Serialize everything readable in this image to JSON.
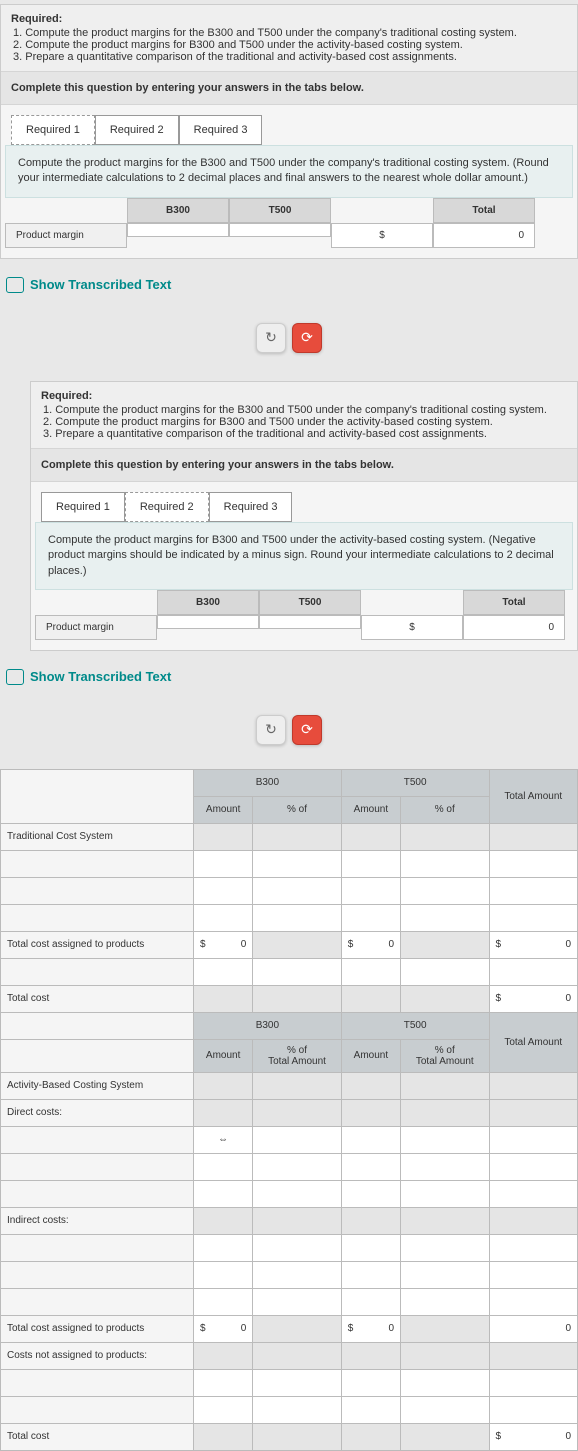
{
  "req": {
    "title": "Required:",
    "items": [
      "1. Compute the product margins for the B300 and T500 under the company's traditional costing system.",
      "2. Compute the product margins for B300 and T500 under the activity-based costing system.",
      "3. Prepare a quantitative comparison of the traditional and activity-based cost assignments."
    ]
  },
  "complete": "Complete this question by entering your answers in the tabs below.",
  "tabs": [
    "Required 1",
    "Required 2",
    "Required 3"
  ],
  "instr1": "Compute the product margins for the B300 and T500 under the company's traditional costing system. (Round your intermediate calculations to 2 decimal places and final answers to the nearest whole dollar amount.)",
  "instr2": "Compute the product margins for B300 and T500 under the activity-based costing system. (Negative product margins should be indicated by a minus sign. Round your intermediate calculations to 2 decimal places.)",
  "cols": {
    "b300": "B300",
    "t500": "T500",
    "total": "Total"
  },
  "row_pm": "Product margin",
  "currency": "$",
  "zero": "0",
  "show_link": "Show Transcribed Text",
  "refresh": "↻",
  "reload": "⟳",
  "comp": {
    "b300": "B300",
    "t500": "T500",
    "amount": "Amount",
    "pct": "% of",
    "total_amt": "Total Amount",
    "total_am": "Total\nAmount",
    "rows": {
      "trad": "Traditional Cost System",
      "tcap": "Total cost assigned to products",
      "tcost": "Total cost",
      "abc": "Activity-Based Costing System",
      "direct": "Direct costs:",
      "indirect": "Indirect costs:",
      "cnap": "Costs not assigned to products:"
    }
  }
}
